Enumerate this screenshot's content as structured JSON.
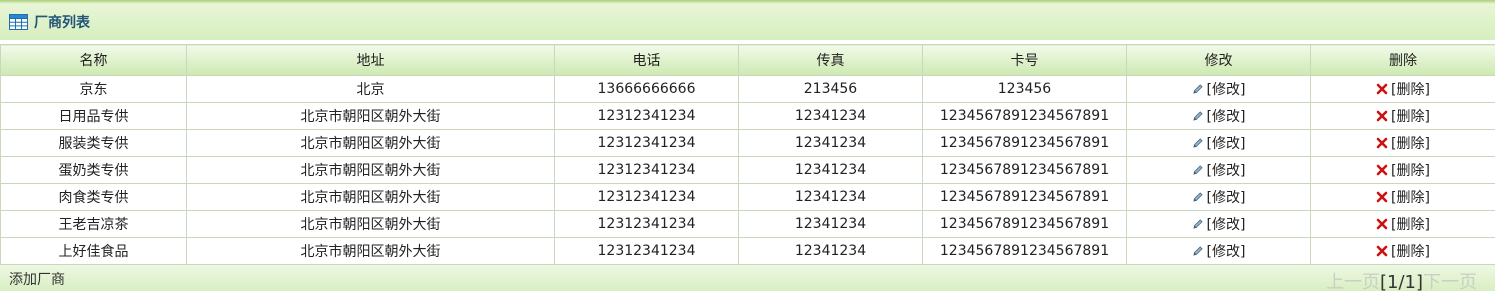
{
  "panel": {
    "title": "厂商列表",
    "icon": "table-icon"
  },
  "table": {
    "columns": [
      "名称",
      "地址",
      "电话",
      "传真",
      "卡号",
      "修改",
      "删除"
    ],
    "rows": [
      {
        "name": "京东",
        "address": "北京",
        "phone": "13666666666",
        "fax": "213456",
        "card": "123456",
        "edit": "[修改]",
        "delete": "[删除]"
      },
      {
        "name": "日用品专供",
        "address": "北京市朝阳区朝外大街",
        "phone": "12312341234",
        "fax": "12341234",
        "card": "1234567891234567891",
        "edit": "[修改]",
        "delete": "[删除]"
      },
      {
        "name": "服装类专供",
        "address": "北京市朝阳区朝外大街",
        "phone": "12312341234",
        "fax": "12341234",
        "card": "1234567891234567891",
        "edit": "[修改]",
        "delete": "[删除]"
      },
      {
        "name": "蛋奶类专供",
        "address": "北京市朝阳区朝外大街",
        "phone": "12312341234",
        "fax": "12341234",
        "card": "1234567891234567891",
        "edit": "[修改]",
        "delete": "[删除]"
      },
      {
        "name": "肉食类专供",
        "address": "北京市朝阳区朝外大街",
        "phone": "12312341234",
        "fax": "12341234",
        "card": "1234567891234567891",
        "edit": "[修改]",
        "delete": "[删除]"
      },
      {
        "name": "王老吉凉茶",
        "address": "北京市朝阳区朝外大街",
        "phone": "12312341234",
        "fax": "12341234",
        "card": "1234567891234567891",
        "edit": "[修改]",
        "delete": "[删除]"
      },
      {
        "name": "上好佳食品",
        "address": "北京市朝阳区朝外大街",
        "phone": "12312341234",
        "fax": "12341234",
        "card": "1234567891234567891",
        "edit": "[修改]",
        "delete": "[删除]"
      }
    ]
  },
  "footer": {
    "add_label": "添加厂商",
    "prev_label": "上一页",
    "page_indicator": "[1/1]",
    "next_label": "下一页"
  },
  "colors": {
    "delete_x": "#cc1111",
    "title_text": "#225577"
  }
}
